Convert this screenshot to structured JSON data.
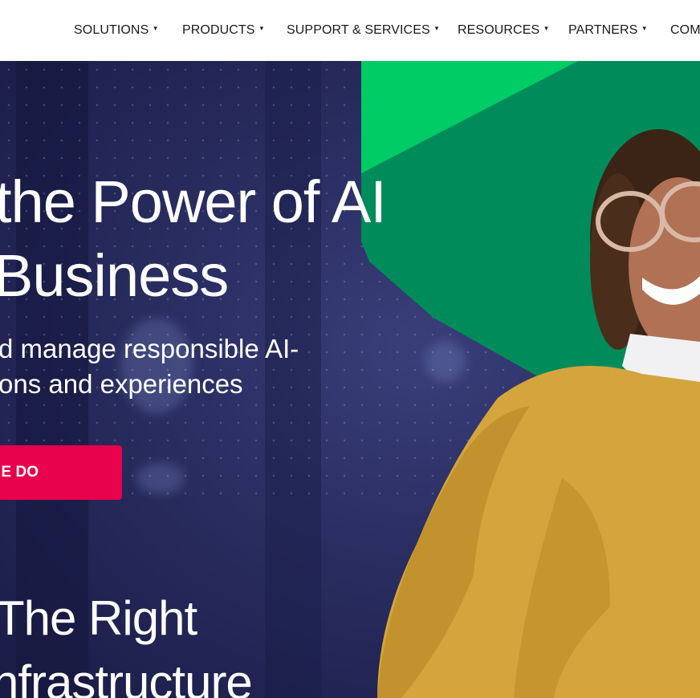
{
  "nav": {
    "items": [
      {
        "label": "SOLUTIONS",
        "caret": "▾"
      },
      {
        "label": "PRODUCTS",
        "caret": "▾"
      },
      {
        "label": "SUPPORT & SERVICES",
        "caret": "▾"
      },
      {
        "label": "RESOURCES",
        "caret": "▾"
      },
      {
        "label": "PARTNERS",
        "caret": "▾"
      },
      {
        "label": "COM"
      }
    ]
  },
  "hero": {
    "headline_line1": "the Power of AI",
    "headline_line2": "Business",
    "subtext_line1": "d manage responsible AI-",
    "subtext_line2": "ons and experiences",
    "cta_label": "E DO",
    "secondary_line1": "The Right",
    "secondary_line2": "nfrastructure",
    "colors": {
      "background": "#1c1f4a",
      "green_light": "#00cc66",
      "green_dark": "#008c5a",
      "cta": "#e8014d",
      "sweater": "#d4a53c"
    }
  }
}
